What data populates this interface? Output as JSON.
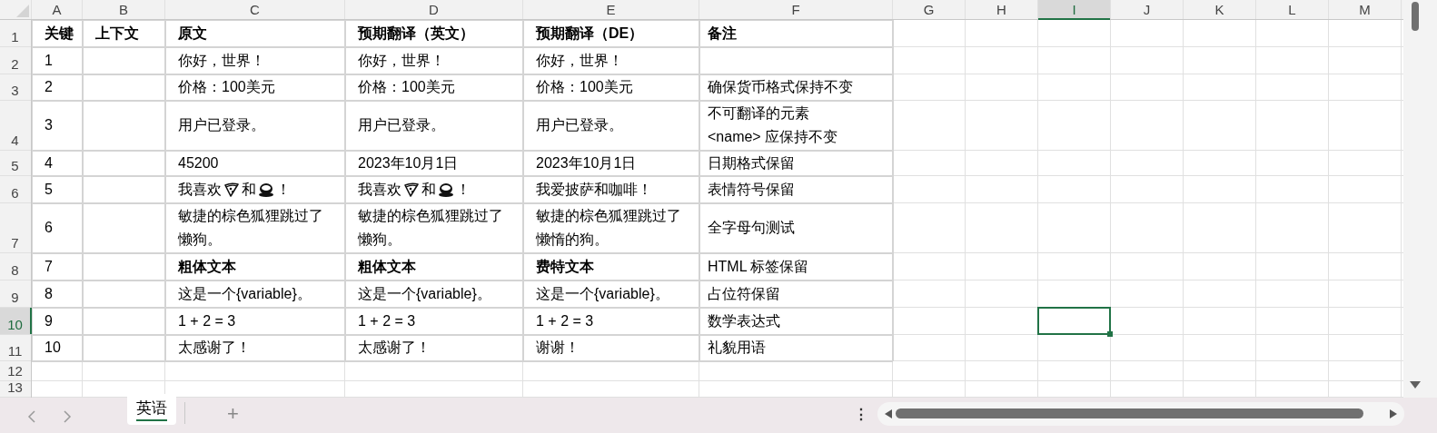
{
  "columns": [
    {
      "label": "A",
      "selected": false
    },
    {
      "label": "B",
      "selected": false
    },
    {
      "label": "C",
      "selected": false
    },
    {
      "label": "D",
      "selected": false
    },
    {
      "label": "E",
      "selected": false
    },
    {
      "label": "F",
      "selected": false
    },
    {
      "label": "G",
      "selected": false
    },
    {
      "label": "H",
      "selected": false
    },
    {
      "label": "I",
      "selected": true
    },
    {
      "label": "J",
      "selected": false
    },
    {
      "label": "K",
      "selected": false
    },
    {
      "label": "L",
      "selected": false
    },
    {
      "label": "M",
      "selected": false
    }
  ],
  "rows": [
    {
      "number": "1",
      "selected": false,
      "cells": [
        {
          "text": "关键",
          "bold": true
        },
        {
          "text": "上下文",
          "bold": true
        },
        {
          "text": "原文",
          "bold": true
        },
        {
          "text": "预期翻译（英文）",
          "bold": true
        },
        {
          "text": "预期翻译（DE）",
          "bold": true
        },
        {
          "text": "备注",
          "bold": true
        }
      ]
    },
    {
      "number": "2",
      "selected": false,
      "cells": [
        {
          "text": "1",
          "bold": false
        },
        null,
        {
          "text": "你好，世界！",
          "bold": false
        },
        {
          "text": "你好，世界！",
          "bold": false
        },
        {
          "text": "你好，世界！",
          "bold": false
        }
      ]
    },
    {
      "number": "3",
      "selected": false,
      "cells": [
        {
          "text": "2",
          "bold": false
        },
        null,
        {
          "text": "价格：100美元",
          "bold": false
        },
        {
          "text": "价格：100美元",
          "bold": false
        },
        {
          "text": "价格：100美元",
          "bold": false
        },
        {
          "text": "确保货币格式保持不变",
          "bold": false
        }
      ]
    },
    {
      "number": "4",
      "selected": false,
      "cells": [
        {
          "text": "3",
          "bold": false
        },
        null,
        {
          "text": "用户已登录。",
          "bold": false
        },
        {
          "text": "用户已登录。",
          "bold": false
        },
        {
          "text": "用户已登录。",
          "bold": false
        },
        {
          "text": "不可翻译的元素\n<name> 应保持不变",
          "bold": false
        }
      ]
    },
    {
      "number": "5",
      "selected": false,
      "cells": [
        {
          "text": "4",
          "bold": false
        },
        null,
        {
          "text": "45200",
          "bold": false
        },
        {
          "text": "2023年10月1日",
          "bold": false
        },
        {
          "text": "2023年10月1日",
          "bold": false
        },
        {
          "text": "日期格式保留",
          "bold": false
        }
      ]
    },
    {
      "number": "6",
      "selected": false,
      "cells": [
        {
          "text": "5",
          "bold": false
        },
        null,
        {
          "bold": false,
          "segments": [
            {
              "kind": "text",
              "text": "我喜欢"
            },
            {
              "kind": "pizza"
            },
            {
              "kind": "text",
              "text": "和"
            },
            {
              "kind": "coffee"
            },
            {
              "kind": "text",
              "text": "！"
            }
          ]
        },
        {
          "bold": false,
          "segments": [
            {
              "kind": "text",
              "text": "我喜欢"
            },
            {
              "kind": "pizza"
            },
            {
              "kind": "text",
              "text": "和"
            },
            {
              "kind": "coffee"
            },
            {
              "kind": "text",
              "text": "！"
            }
          ]
        },
        {
          "text": "我爱披萨和咖啡！",
          "bold": false
        },
        {
          "text": "表情符号保留",
          "bold": false
        }
      ]
    },
    {
      "number": "7",
      "selected": false,
      "cells": [
        {
          "text": "6",
          "bold": false
        },
        null,
        {
          "text": "敏捷的棕色狐狸跳过了懒狗。",
          "bold": false
        },
        {
          "text": "敏捷的棕色狐狸跳过了懒狗。",
          "bold": false
        },
        {
          "text": "敏捷的棕色狐狸跳过了懒惰的狗。",
          "bold": false
        },
        {
          "text": "全字母句测试",
          "bold": false
        }
      ]
    },
    {
      "number": "8",
      "selected": false,
      "cells": [
        {
          "text": "7",
          "bold": false
        },
        null,
        {
          "text": "粗体文本",
          "bold": true
        },
        {
          "text": "粗体文本",
          "bold": true
        },
        {
          "text": "费特文本",
          "bold": true
        },
        {
          "text": "HTML 标签保留",
          "bold": false
        }
      ]
    },
    {
      "number": "9",
      "selected": false,
      "cells": [
        {
          "text": "8",
          "bold": false
        },
        null,
        {
          "text": "这是一个{variable}。",
          "bold": false
        },
        {
          "text": "这是一个{variable}。",
          "bold": false
        },
        {
          "text": "这是一个{variable}。",
          "bold": false
        },
        {
          "text": "占位符保留",
          "bold": false
        }
      ]
    },
    {
      "number": "10",
      "selected": true,
      "cells": [
        {
          "text": "9",
          "bold": false
        },
        null,
        {
          "text": "1 + 2 = 3",
          "bold": false
        },
        {
          "text": "1 + 2 = 3",
          "bold": false
        },
        {
          "text": "1 + 2 = 3",
          "bold": false
        },
        {
          "text": "数学表达式",
          "bold": false
        }
      ]
    },
    {
      "number": "11",
      "selected": false,
      "cells": [
        {
          "text": "10",
          "bold": false
        },
        null,
        {
          "text": "太感谢了！",
          "bold": false
        },
        {
          "text": "太感谢了！",
          "bold": false
        },
        {
          "text": "谢谢！",
          "bold": false
        },
        {
          "text": "礼貌用语",
          "bold": false
        }
      ]
    },
    {
      "number": "12",
      "selected": false
    },
    {
      "number": "13",
      "selected": false
    }
  ],
  "sheet_tabs": [
    {
      "label": "英语",
      "selected": true
    }
  ],
  "add_sheet": "+",
  "more_menu": "⋮"
}
